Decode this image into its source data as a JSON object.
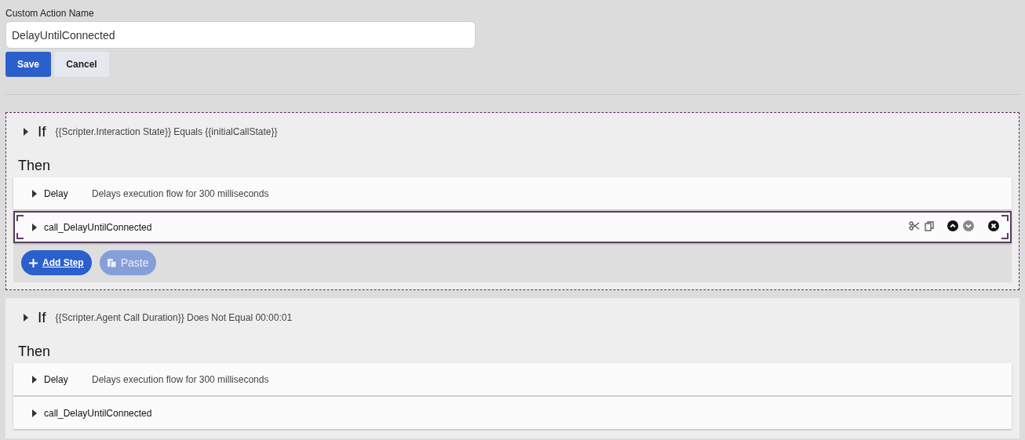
{
  "name_field": {
    "label": "Custom Action Name",
    "value": "DelayUntilConnected"
  },
  "buttons": [
    {
      "label": "Save",
      "kind": "primary"
    },
    {
      "label": "Cancel",
      "kind": "secondary"
    }
  ],
  "blocks": [
    {
      "selected": true,
      "keyword": "If",
      "condition": "{{Scripter.Interaction State}} Equals {{initialCallState}}",
      "then_label": "Then",
      "steps": [
        {
          "name": "Delay",
          "description": "Delays execution flow for 300 milliseconds",
          "selected": false
        },
        {
          "name": "call_DelayUntilConnected",
          "selected": true
        }
      ],
      "actions": [
        {
          "label": "Add Step",
          "kind": "add",
          "disabled": false
        },
        {
          "label": "Paste",
          "kind": "paste",
          "disabled": true
        }
      ]
    },
    {
      "selected": false,
      "keyword": "If",
      "condition": "{{Scripter.Agent Call Duration}} Does Not Equal 00:00:01",
      "then_label": "Then",
      "steps": [
        {
          "name": "Delay",
          "description": "Delays execution flow for 300 milliseconds",
          "selected": false
        },
        {
          "name": "call_DelayUntilConnected",
          "selected": false
        }
      ]
    }
  ]
}
